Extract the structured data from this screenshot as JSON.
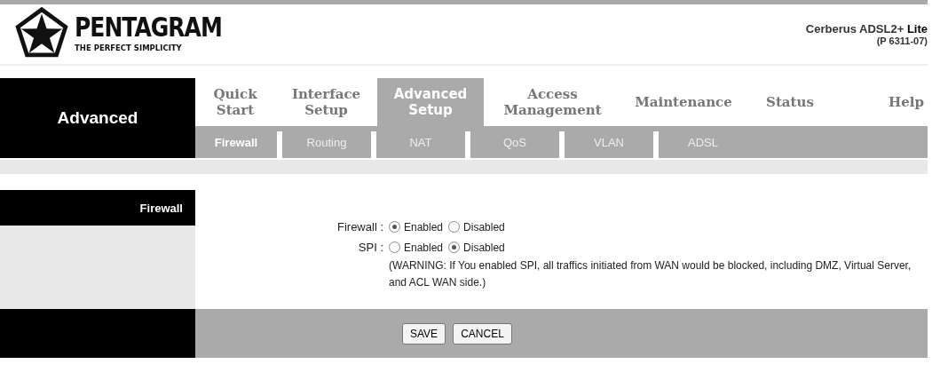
{
  "header": {
    "brand": "PENTAGRAM",
    "tagline": "THE PERFECT SIMPLICITY",
    "model_name": "Cerberus ADSL2+ ",
    "model_suffix": "Lite",
    "model_code": "(P 6311-07)"
  },
  "section_title": "Advanced",
  "tabs": [
    {
      "label": "Quick Start",
      "selected": false
    },
    {
      "label": "Interface Setup",
      "selected": false
    },
    {
      "label": "Advanced Setup",
      "selected": true
    },
    {
      "label": "Access Management",
      "selected": false
    },
    {
      "label": "Maintenance",
      "selected": false
    },
    {
      "label": "Status",
      "selected": false
    },
    {
      "label": "Help",
      "selected": false
    }
  ],
  "subtabs": [
    {
      "label": "Firewall",
      "selected": true
    },
    {
      "label": "Routing",
      "selected": false
    },
    {
      "label": "NAT",
      "selected": false
    },
    {
      "label": "QoS",
      "selected": false
    },
    {
      "label": "VLAN",
      "selected": false
    },
    {
      "label": "ADSL",
      "selected": false
    }
  ],
  "panel_title": "Firewall",
  "settings": [
    {
      "label": "Firewall :",
      "options": [
        {
          "label": "Enabled",
          "selected": true
        },
        {
          "label": "Disabled",
          "selected": false
        }
      ]
    },
    {
      "label": "SPI :",
      "options": [
        {
          "label": "Enabled",
          "selected": false
        },
        {
          "label": "Disabled",
          "selected": true
        }
      ]
    }
  ],
  "warning": "(WARNING: If You enabled SPI, all traffics initiated from WAN would be blocked, including DMZ, Virtual Server, and ACL WAN side.)",
  "buttons": [
    "SAVE",
    "CANCEL"
  ]
}
